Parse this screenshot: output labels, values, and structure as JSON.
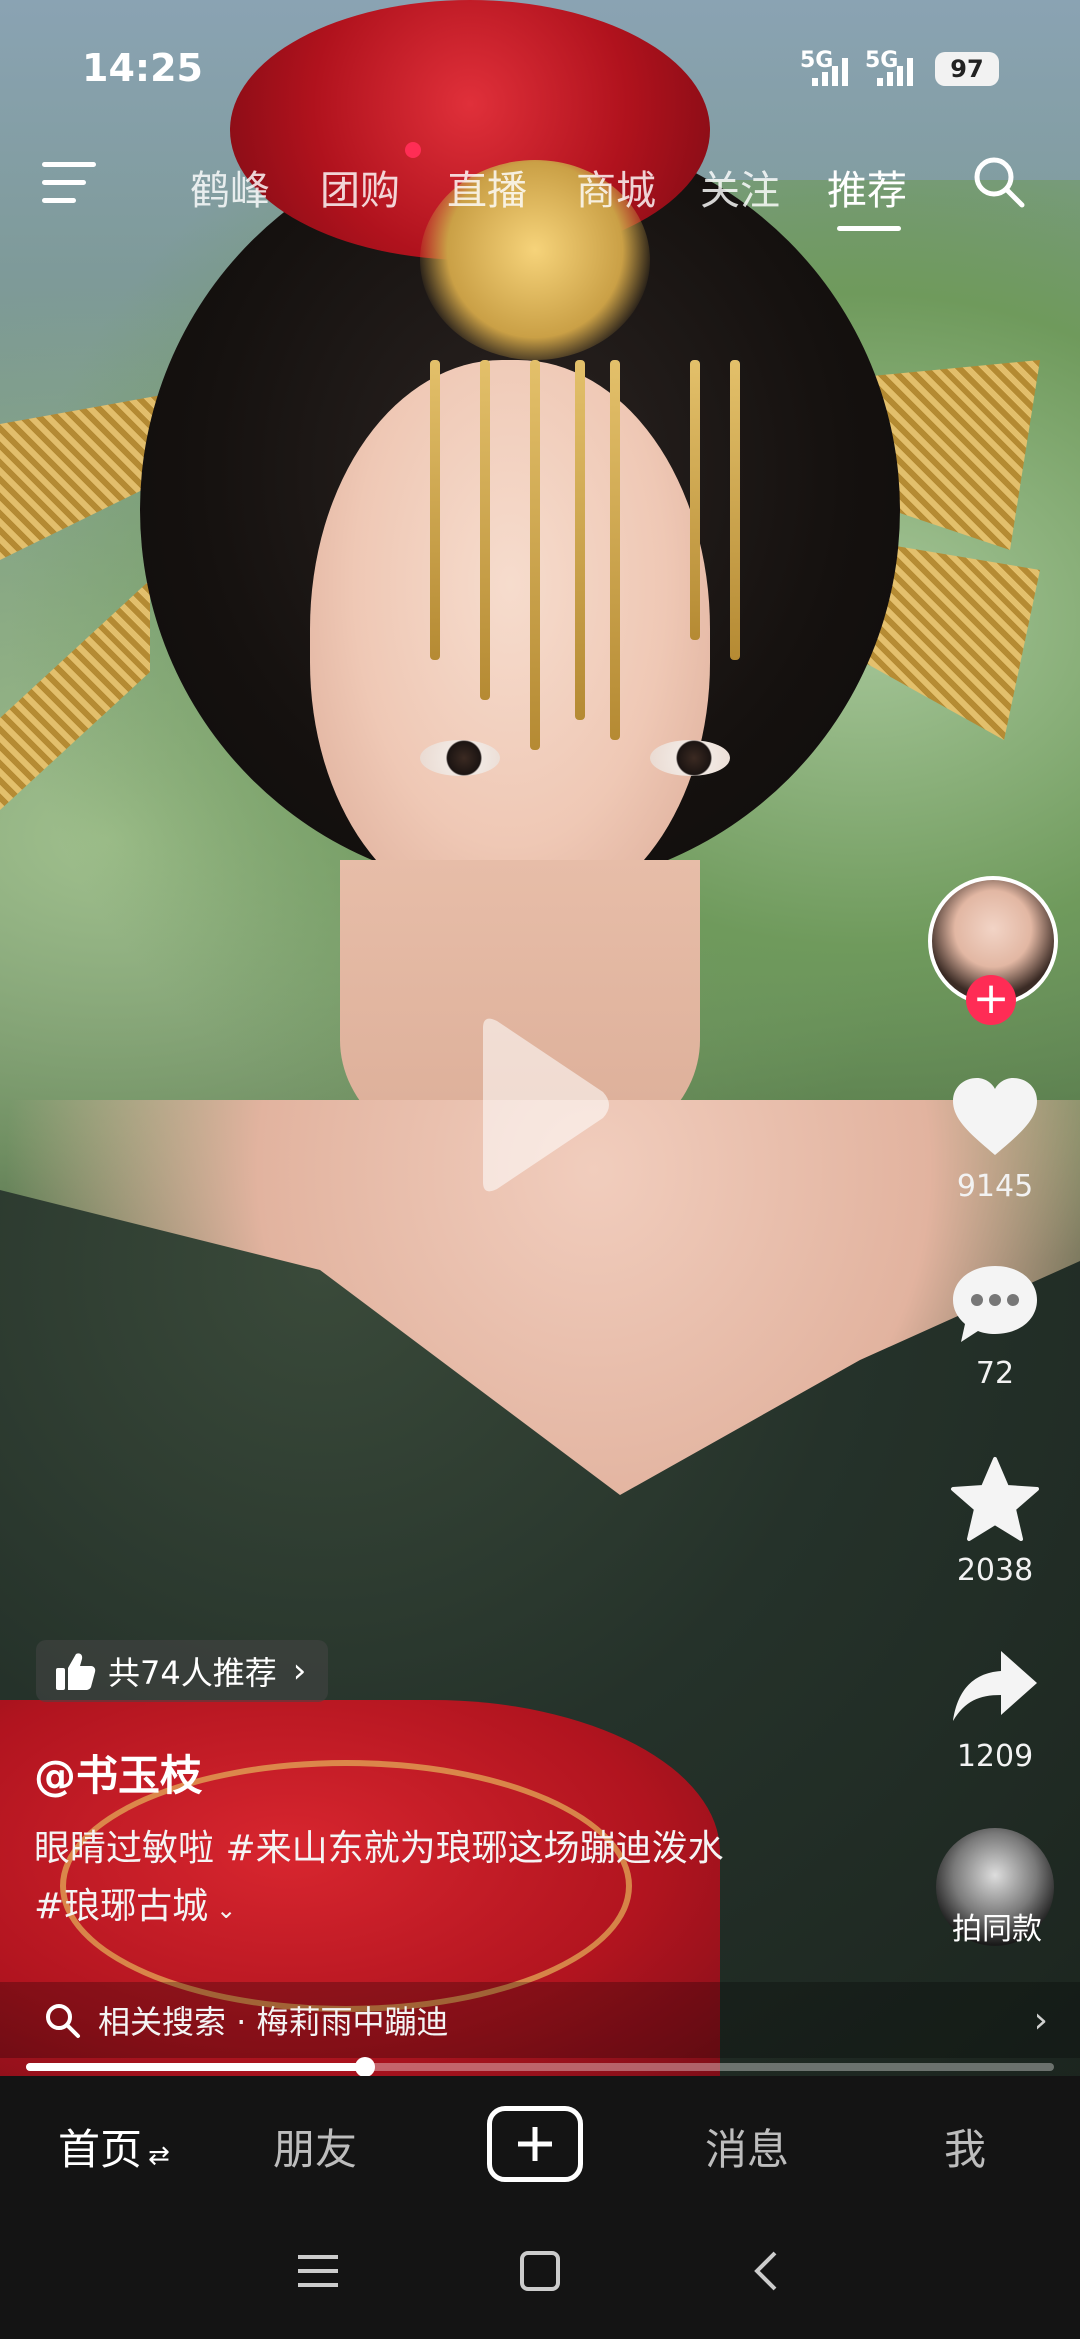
{
  "status_bar": {
    "time": "14:25",
    "sim1": "5G",
    "sim2": "5G",
    "battery": "97"
  },
  "top_nav": {
    "tabs": [
      {
        "label": "鹤峰",
        "active": false
      },
      {
        "label": "团购",
        "active": false
      },
      {
        "label": "直播",
        "active": false
      },
      {
        "label": "商城",
        "active": false
      },
      {
        "label": "关注",
        "active": false
      },
      {
        "label": "推荐",
        "active": true
      }
    ]
  },
  "video": {
    "state": "paused",
    "progress": 0.33
  },
  "side_actions": {
    "likes": "9145",
    "comments": "72",
    "favorites": "2038",
    "shares": "1209",
    "same_style_label": "拍同款"
  },
  "recommend": {
    "text": "共74人推荐"
  },
  "post": {
    "author": "@书玉枝",
    "description_line1": "眼睛过敏啦 #来山东就为琅琊这场蹦迪泼水",
    "description_line2": "#琅琊古城"
  },
  "related_search": {
    "text": "相关搜索 · 梅莉雨中蹦迪"
  },
  "bottom_nav": {
    "home": "首页",
    "friends": "朋友",
    "messages": "消息",
    "me": "我"
  },
  "colors": {
    "accent": "#ff2c55",
    "nav_bg": "#141414"
  }
}
